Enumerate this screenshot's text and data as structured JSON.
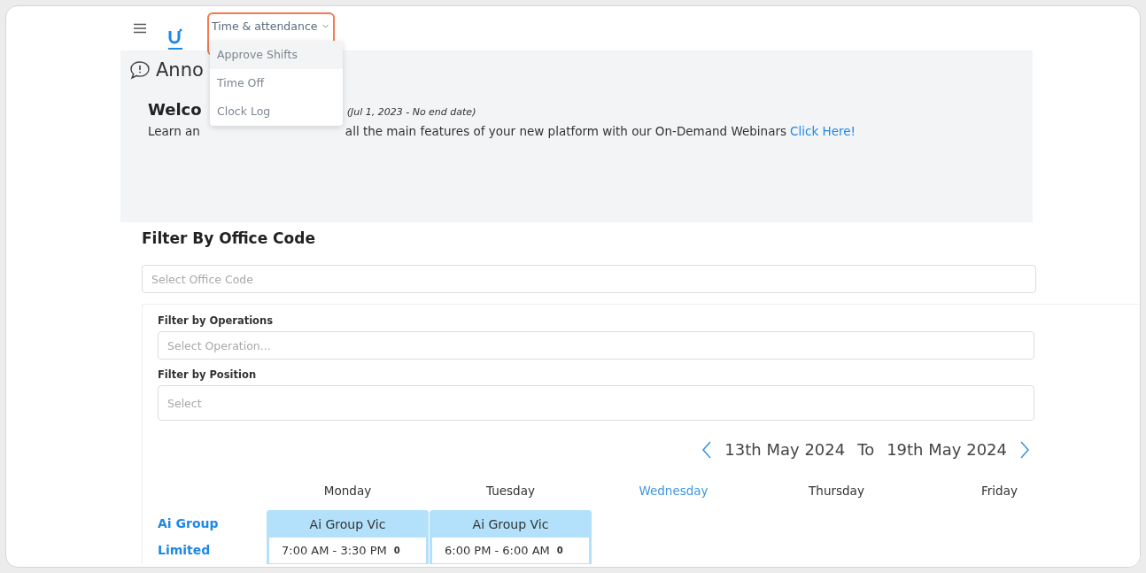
{
  "nav": {
    "menu_title": "Time & attendance",
    "expanded": true,
    "items": [
      {
        "label": "Approve Shifts",
        "selected": true
      },
      {
        "label": "Time Off",
        "selected": false
      },
      {
        "label": "Clock Log",
        "selected": false
      }
    ]
  },
  "announcement": {
    "title": "Anno",
    "welcome_title": "Welco",
    "date_range": "(Jul 1, 2023 - No end date)",
    "text_start": "Learn an",
    "text_rest": "all the main features of your new platform with our On-Demand Webinars",
    "link": "Click Here!"
  },
  "filter": {
    "title": "Filter By Office Code",
    "office_placeholder": "Select Office Code",
    "operations_label": "Filter by Operations",
    "operations_placeholder": "Select Operation...",
    "position_label": "Filter by Position",
    "position_placeholder": "Select"
  },
  "week": {
    "from": "13th May 2024",
    "to_word": "To",
    "to": "19th May 2024"
  },
  "days": [
    {
      "label": "Monday",
      "selected": false
    },
    {
      "label": "Tuesday",
      "selected": false
    },
    {
      "label": "Wednesday",
      "selected": true
    },
    {
      "label": "Thursday",
      "selected": false
    },
    {
      "label": "Friday",
      "selected": false
    }
  ],
  "rows": [
    {
      "group": "Ai Group Limited",
      "shifts": [
        {
          "title": "Ai Group Vic",
          "time": "7:00 AM - 3:30 PM",
          "count": "0"
        },
        {
          "title": "Ai Group Vic",
          "time": "6:00 PM - 6:00 AM",
          "count": "0"
        }
      ]
    }
  ]
}
